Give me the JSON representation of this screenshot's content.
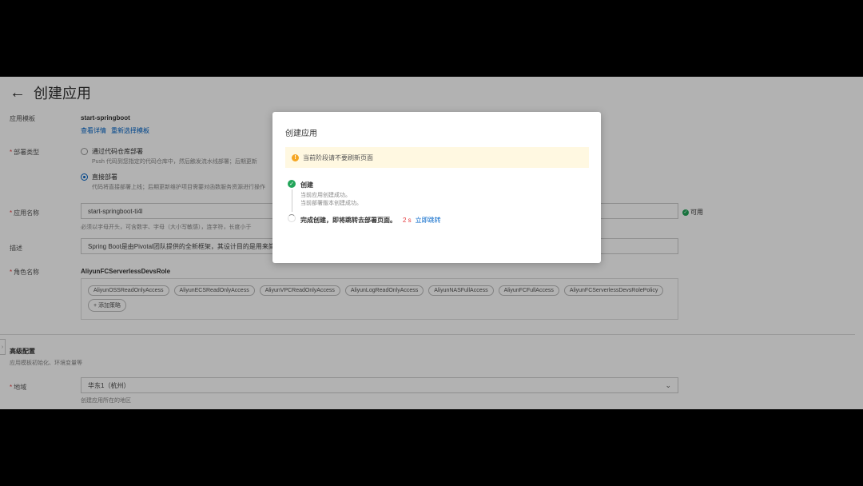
{
  "page": {
    "title": "创建应用",
    "template_label": "应用模板",
    "template_name": "start-springboot",
    "view_details": "查看详情",
    "reselect_template": "重新选择模板",
    "deploy_type_label": "部署类型",
    "deploy_option_repo": "通过代码仓库部署",
    "deploy_option_repo_hint": "Push 代码到您指定的代码仓库中，然后触发流水线部署；后期更新",
    "deploy_option_direct": "直接部署",
    "deploy_option_direct_hint": "代码将直接部署上线；后期更新维护项目需要对函数服务资源进行操作",
    "app_name_label": "应用名称",
    "app_name_value": "start-springboot-ti4l",
    "app_name_status": "可用",
    "app_name_hint": "必须以字母开头，可含数字、字母（大小写敏感），连字符，长度小于",
    "description_label": "描述",
    "description_value": "Spring Boot是由Pivotal团队提供的全新框架，其设计目的是用来简化",
    "role_label": "角色名称",
    "role_name": "AliyunFCServerlessDevsRole",
    "policies": [
      "AliyunOSSReadOnlyAccess",
      "AliyunECSReadOnlyAccess",
      "AliyunVPCReadOnlyAccess",
      "AliyunLogReadOnlyAccess",
      "AliyunNASFullAccess",
      "AliyunFCFullAccess",
      "AliyunFCServerlessDevsRolePolicy"
    ],
    "add_policy": "+ 添加策略",
    "advanced_title": "高级配置",
    "advanced_hint": "应用模板初始化、环境变量等",
    "region_label": "地域",
    "region_value": "华东1（杭州）",
    "region_hint": "创建应用所在的地区"
  },
  "modal": {
    "title": "创建应用",
    "notice": "当前阶段请不要刷新页面",
    "step1_title": "创建",
    "step1_line1": "当前应用创建成功。",
    "step1_line2": "当前部署版本创建成功。",
    "step2_title": "完成创建，即将跳转去部署页面。",
    "countdown": "2 s",
    "jump_now": "立即跳转"
  },
  "colors": {
    "primary": "#0064c8",
    "success": "#23a55a",
    "warning": "#f5a623",
    "danger": "#e4393c"
  }
}
